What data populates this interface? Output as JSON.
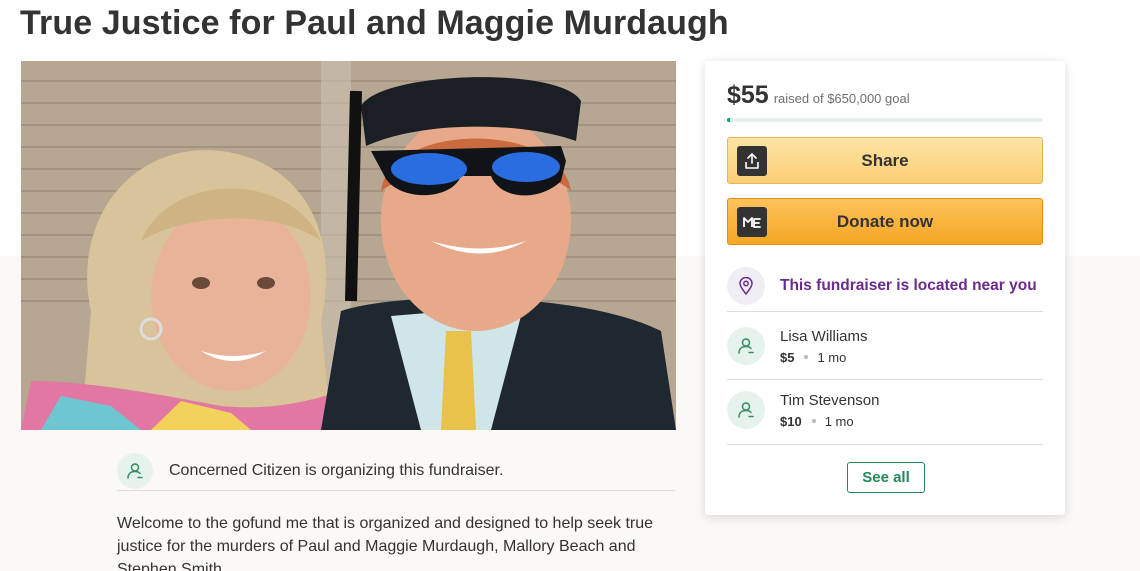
{
  "page": {
    "title": "True Justice for Paul and Maggie Murdaugh"
  },
  "organizer": {
    "text": "Concerned Citizen is organizing this fundraiser."
  },
  "story": {
    "text": "Welcome to the gofund me that is organized and designed to help seek true justice for the murders of Paul and Maggie Murdaugh, Mallory Beach and Stephen Smith."
  },
  "donation_panel": {
    "raised_amount": "$55",
    "goal_text": "raised of $650,000 goal",
    "progress_fraction": 0.0001,
    "share_label": "Share",
    "donate_label": "Donate now",
    "nearby_text": "This fundraiser is located near you",
    "donors": [
      {
        "name": "Lisa Williams",
        "amount": "$5",
        "time": "1 mo"
      },
      {
        "name": "Tim Stevenson",
        "amount": "$10",
        "time": "1 mo"
      }
    ],
    "see_all_label": "See all"
  },
  "icons": {
    "share": "share-upload-icon",
    "donate": "gofundme-logo-icon",
    "location": "location-pin-icon",
    "person": "person-icon"
  },
  "colors": {
    "accent_green": "#02a95c",
    "share_button": "#fbce74",
    "donate_button": "#f6a623",
    "nearby_purple": "#6b2a8e"
  }
}
